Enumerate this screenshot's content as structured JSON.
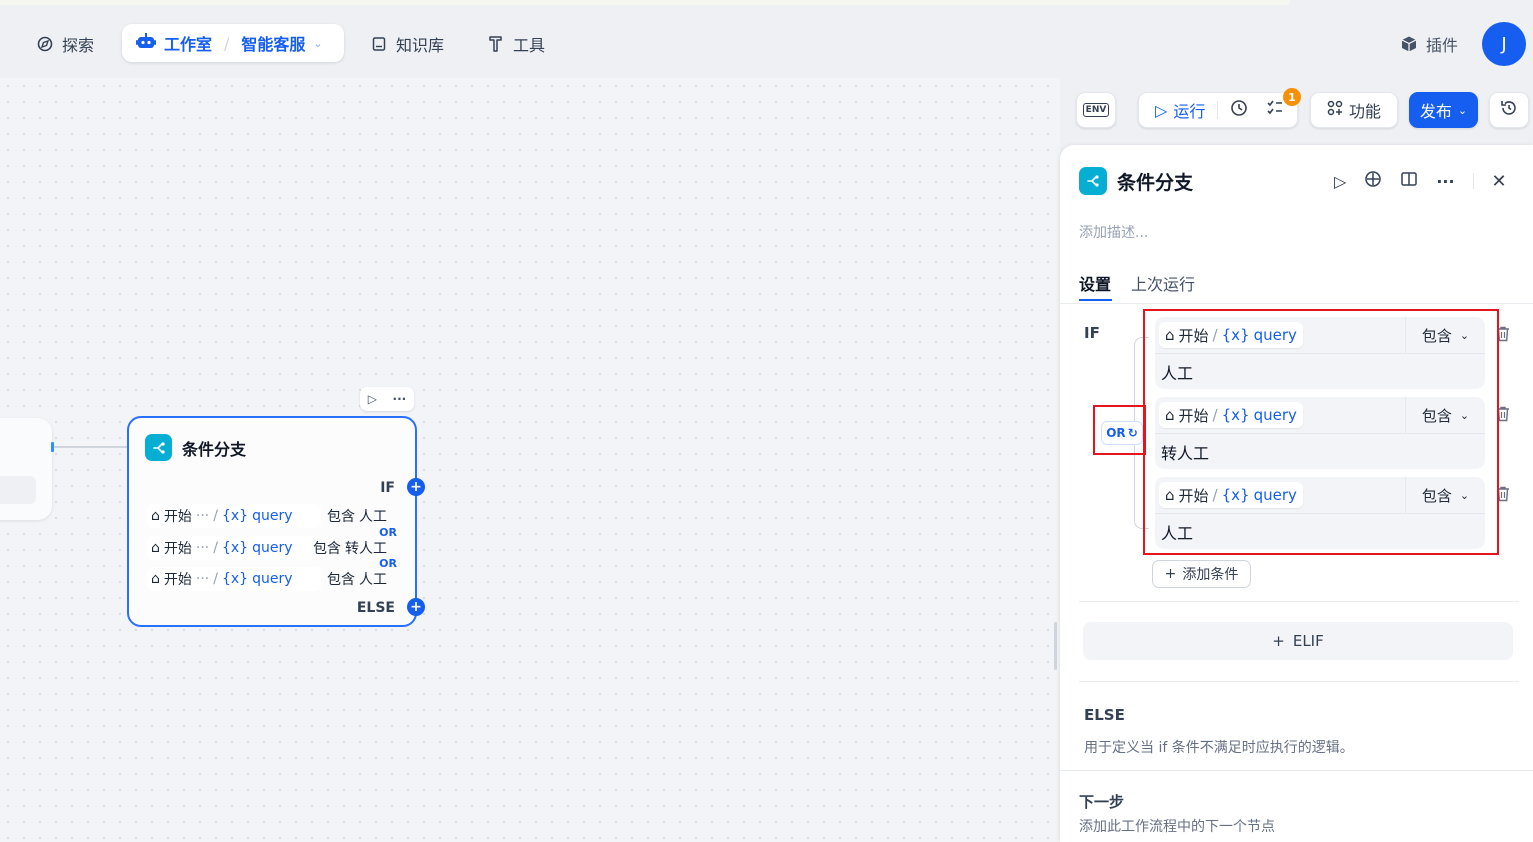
{
  "topnav": {
    "explore": "探索",
    "studio": "工作室",
    "app_name": "智能客服",
    "knowledge": "知识库",
    "tools": "工具",
    "plugins": "插件",
    "avatar_initial": "J"
  },
  "toolbar": {
    "env": "ENV",
    "run": "运行",
    "checklist_badge": "1",
    "features": "功能",
    "publish": "发布"
  },
  "node": {
    "title": "条件分支",
    "if_label": "IF",
    "else_label": "ELSE",
    "or_label": "OR",
    "conditions": [
      {
        "source": "开始",
        "ellipsis": "···",
        "var": "query",
        "op": "包含",
        "value": "人工"
      },
      {
        "source": "开始",
        "ellipsis": "···",
        "var": "query",
        "op": "包含",
        "value": "转人工"
      },
      {
        "source": "开始",
        "ellipsis": "···",
        "var": "query",
        "op": "包含",
        "value": "人工"
      }
    ]
  },
  "panel": {
    "title": "条件分支",
    "description_placeholder": "添加描述...",
    "tabs": [
      "设置",
      "上次运行"
    ],
    "if_label": "IF",
    "logic_operator": "OR",
    "conditions": [
      {
        "source": "开始",
        "var": "query",
        "op": "包含",
        "value": "人工"
      },
      {
        "source": "开始",
        "var": "query",
        "op": "包含",
        "value": "转人工"
      },
      {
        "source": "开始",
        "var": "query",
        "op": "包含",
        "value": "人工"
      }
    ],
    "add_condition": "添加条件",
    "elif_button": "ELIF",
    "else_title": "ELSE",
    "else_desc": "用于定义当 if 条件不满足时应执行的逻辑。",
    "next_title": "下一步",
    "next_desc": "添加此工作流程中的下一个节点"
  },
  "colors": {
    "accent": "#155eef",
    "node_icon": "#06aed4",
    "highlight": "#e5141d",
    "badge": "#f79009"
  }
}
